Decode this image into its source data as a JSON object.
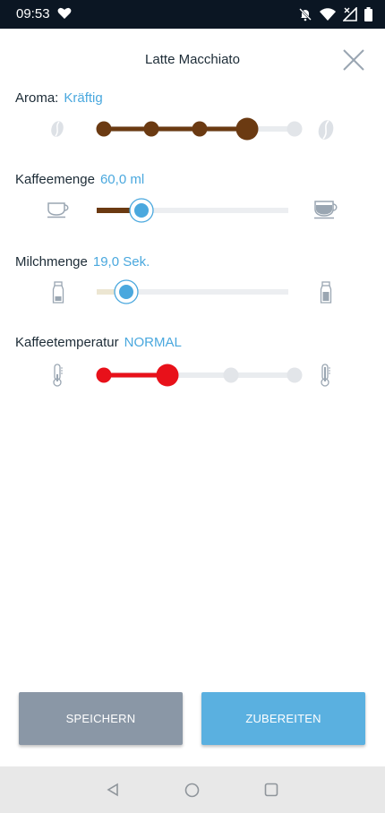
{
  "status_bar": {
    "time": "09:53"
  },
  "header": {
    "title": "Latte Macchiato"
  },
  "settings": {
    "aroma": {
      "label": "Aroma:",
      "value": "Kräftig",
      "level": 4,
      "steps": 5,
      "color": "#6b3a12"
    },
    "kaffeemenge": {
      "label": "Kaffeemenge",
      "value": "60,0 ml",
      "fraction": 0.24,
      "color": "#6b3a12"
    },
    "milchmenge": {
      "label": "Milchmenge",
      "value": "19,0 Sek.",
      "fraction": 0.16,
      "color": "#ece6d2"
    },
    "temperatur": {
      "label": "Kaffeetemperatur",
      "value": "NORMAL",
      "level": 2,
      "steps": 4,
      "color": "#e8111a"
    }
  },
  "buttons": {
    "save": "SPEICHERN",
    "prepare": "ZUBEREITEN"
  },
  "colors": {
    "accent": "#4aa8de",
    "track": "#e9ecef",
    "save_button": "#8a97a6",
    "prepare_button": "#5ab0e0"
  },
  "icons": {
    "aroma": [
      "bean-icon",
      "bean-icon"
    ],
    "kaffeemenge": [
      "small-cup-icon",
      "large-cup-icon"
    ],
    "milchmenge": [
      "small-milk-bottle-icon",
      "large-milk-bottle-icon"
    ],
    "temperatur": [
      "thermometer-low-icon",
      "thermometer-high-icon"
    ]
  }
}
